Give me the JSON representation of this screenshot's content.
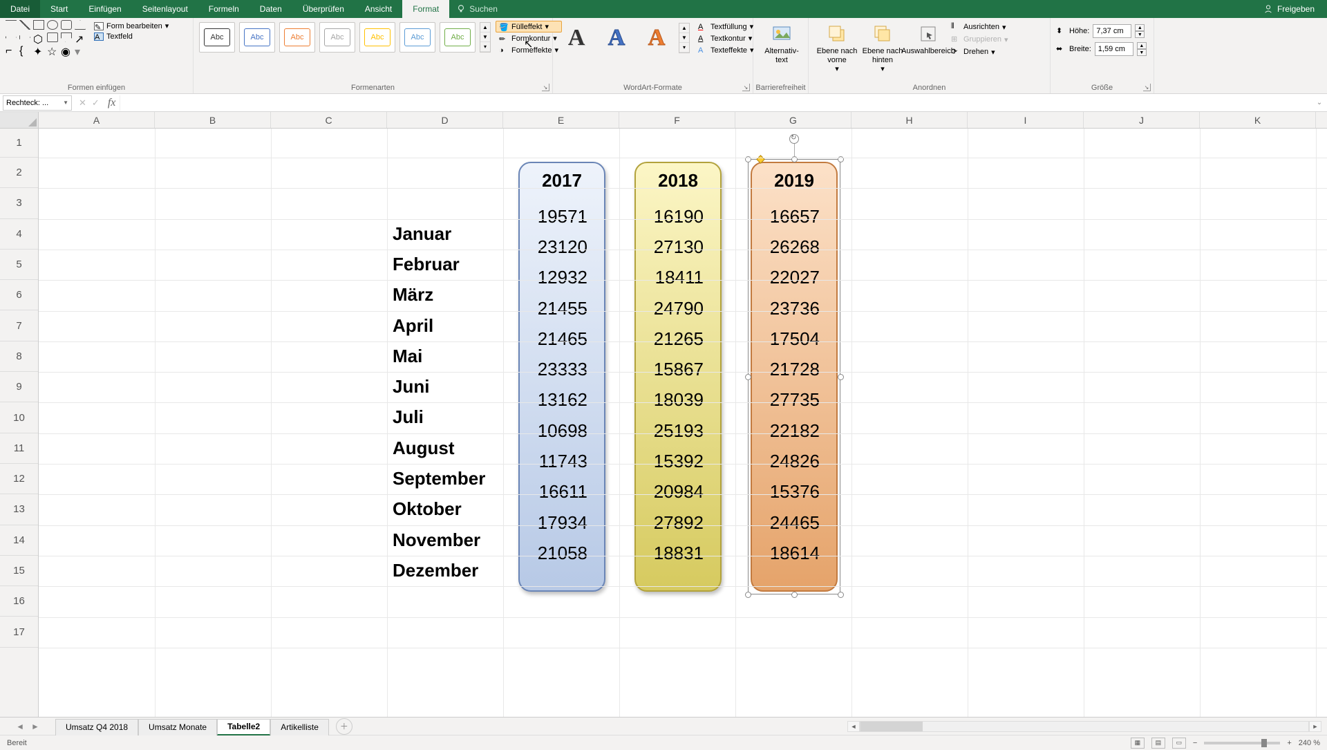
{
  "menu": {
    "file": "Datei",
    "tabs": [
      "Start",
      "Einfügen",
      "Seitenlayout",
      "Formeln",
      "Daten",
      "Überprüfen",
      "Ansicht",
      "Format"
    ],
    "active": "Format",
    "search": "Suchen",
    "share": "Freigeben"
  },
  "ribbon": {
    "insert_shapes": {
      "label": "Formen einfügen",
      "edit_shape": "Form bearbeiten",
      "textfield": "Textfeld"
    },
    "shape_styles": {
      "label": "Formenarten",
      "thumb": "Abc",
      "fill": "Fülleffekt",
      "outline": "Formkontur",
      "effects": "Formeffekte"
    },
    "wordart": {
      "label": "WordArt-Formate",
      "thumb": "A",
      "textfill": "Textfüllung",
      "textoutline": "Textkontur",
      "texteffects": "Texteffekte"
    },
    "access": {
      "label": "Barrierefreiheit",
      "alt": "Alternativ-\ntext"
    },
    "arrange": {
      "label": "Anordnen",
      "front": "Ebene nach\nvorne",
      "back": "Ebene nach\nhinten",
      "selpane": "Auswahlbereich",
      "align": "Ausrichten",
      "group": "Gruppieren",
      "rotate": "Drehen"
    },
    "size": {
      "label": "Größe",
      "height_lbl": "Höhe:",
      "width_lbl": "Breite:",
      "height": "7,37 cm",
      "width": "1,59 cm"
    }
  },
  "namebox": "Rechteck: ...",
  "columns": [
    "A",
    "B",
    "C",
    "D",
    "E",
    "F",
    "G",
    "H",
    "I",
    "J",
    "K"
  ],
  "row_count": 17,
  "months": [
    "Januar",
    "Februar",
    "März",
    "April",
    "Mai",
    "Juni",
    "Juli",
    "August",
    "September",
    "Oktober",
    "November",
    "Dezember"
  ],
  "years": {
    "2017": [
      19571,
      23120,
      12932,
      21455,
      21465,
      23333,
      13162,
      10698,
      11743,
      16611,
      17934,
      21058
    ],
    "2018": [
      16190,
      27130,
      18411,
      24790,
      21265,
      15867,
      18039,
      25193,
      15392,
      20984,
      27892,
      18831
    ],
    "2019": [
      16657,
      26268,
      22027,
      23736,
      17504,
      21728,
      27735,
      22182,
      24826,
      15376,
      24465,
      18614
    ]
  },
  "sheets": {
    "list": [
      "Umsatz Q4 2018",
      "Umsatz Monate",
      "Tabelle2",
      "Artikelliste"
    ],
    "active": "Tabelle2"
  },
  "status": {
    "ready": "Bereit",
    "zoom": "240 %"
  },
  "chart_data": {
    "type": "table",
    "title": "",
    "row_labels": [
      "Januar",
      "Februar",
      "März",
      "April",
      "Mai",
      "Juni",
      "Juli",
      "August",
      "September",
      "Oktober",
      "November",
      "Dezember"
    ],
    "series": [
      {
        "name": "2017",
        "values": [
          19571,
          23120,
          12932,
          21455,
          21465,
          23333,
          13162,
          10698,
          11743,
          16611,
          17934,
          21058
        ]
      },
      {
        "name": "2018",
        "values": [
          16190,
          27130,
          18411,
          24790,
          21265,
          15867,
          18039,
          25193,
          15392,
          20984,
          27892,
          18831
        ]
      },
      {
        "name": "2019",
        "values": [
          16657,
          26268,
          22027,
          23736,
          17504,
          21728,
          27735,
          22182,
          24826,
          15376,
          24465,
          18614
        ]
      }
    ]
  }
}
